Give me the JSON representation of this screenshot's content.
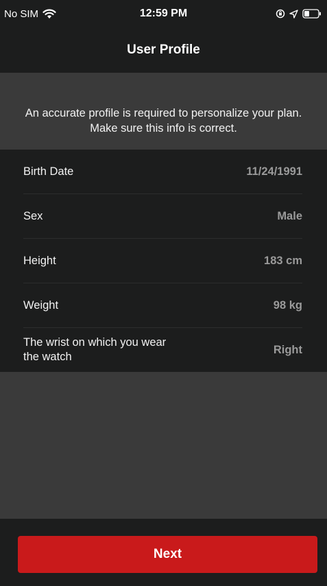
{
  "status_bar": {
    "carrier": "No SIM",
    "time": "12:59 PM"
  },
  "nav": {
    "title": "User Profile"
  },
  "notice": {
    "text": "An accurate profile is required to personalize your plan. Make sure this info is correct."
  },
  "profile": {
    "rows": [
      {
        "label": "Birth Date",
        "value": "11/24/1991"
      },
      {
        "label": "Sex",
        "value": "Male"
      },
      {
        "label": "Height",
        "value": "183 cm"
      },
      {
        "label": "Weight",
        "value": "98 kg"
      },
      {
        "label": "The wrist on which you wear the watch",
        "value": "Right"
      }
    ]
  },
  "footer": {
    "next_label": "Next"
  },
  "colors": {
    "background": "#3a3a3a",
    "panel": "#1c1d1d",
    "accent": "#c91a1b",
    "value_text": "#9a9a9a"
  }
}
